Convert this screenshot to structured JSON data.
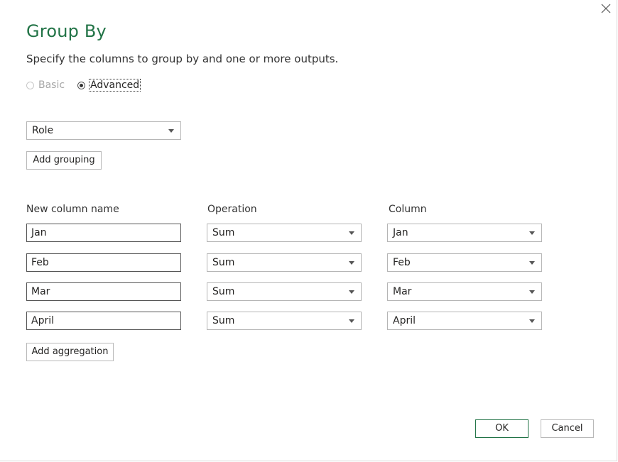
{
  "dialog": {
    "title": "Group By",
    "subtitle": "Specify the columns to group by and one or more outputs."
  },
  "mode": {
    "basic_label": "Basic",
    "advanced_label": "Advanced",
    "selected": "Advanced"
  },
  "grouping": {
    "selected_column": "Role",
    "add_grouping_label": "Add grouping"
  },
  "aggregations": {
    "headers": {
      "new_column_name": "New column name",
      "operation": "Operation",
      "column": "Column"
    },
    "rows": [
      {
        "name": "Jan",
        "operation": "Sum",
        "column": "Jan"
      },
      {
        "name": "Feb",
        "operation": "Sum",
        "column": "Feb"
      },
      {
        "name": "Mar",
        "operation": "Sum",
        "column": "Mar"
      },
      {
        "name": "April",
        "operation": "Sum",
        "column": "April"
      }
    ],
    "add_aggregation_label": "Add aggregation"
  },
  "footer": {
    "ok_label": "OK",
    "cancel_label": "Cancel"
  },
  "colors": {
    "accent": "#217346",
    "text": "#252423",
    "disabled": "#a6a6a6"
  },
  "icons": {
    "close": "close-icon",
    "dropdown": "chevron-down-icon"
  }
}
